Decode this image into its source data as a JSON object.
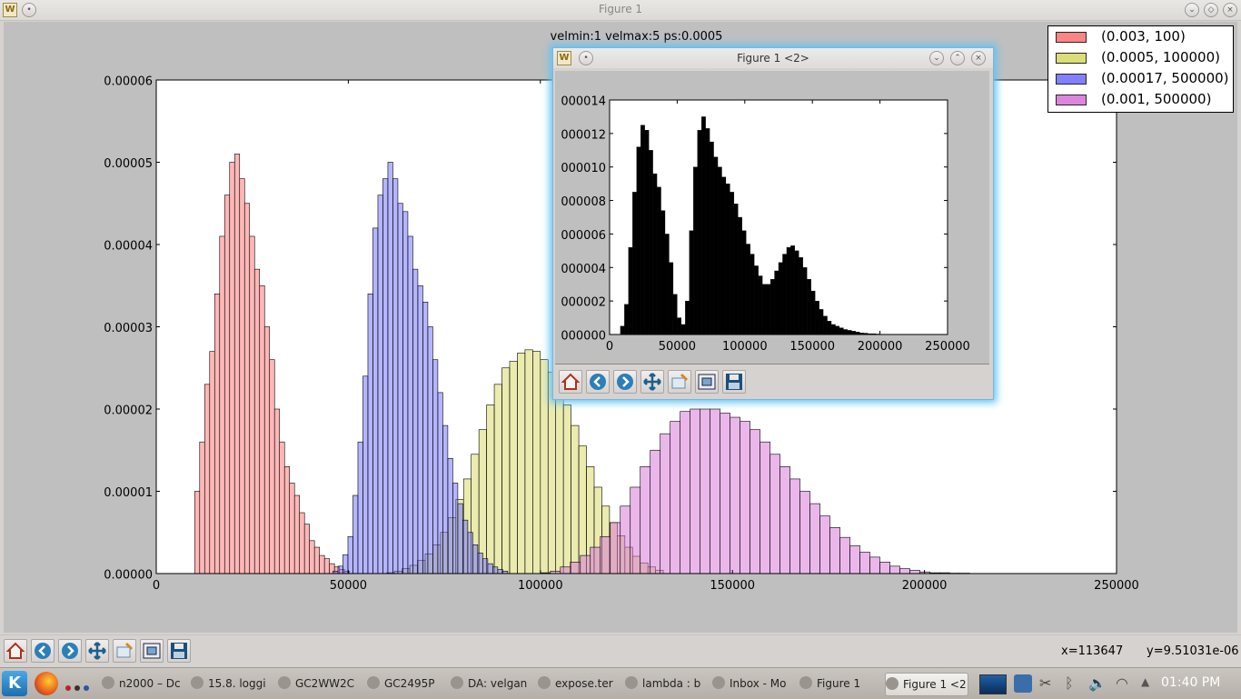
{
  "window": {
    "title": "Figure 1",
    "icon": "matplotlib-icon",
    "status": {
      "x": "x=113647",
      "y": "y=9.51031e-06"
    }
  },
  "toolbar": {
    "buttons": [
      {
        "name": "home-button",
        "icon": "home-icon"
      },
      {
        "name": "back-button",
        "icon": "arrow-left-icon"
      },
      {
        "name": "forward-button",
        "icon": "arrow-right-icon"
      },
      {
        "name": "pan-button",
        "icon": "move-icon"
      },
      {
        "name": "zoom-button",
        "icon": "zoom-rect-icon"
      },
      {
        "name": "subplots-button",
        "icon": "subplots-icon"
      },
      {
        "name": "save-button",
        "icon": "floppy-disk-icon"
      }
    ]
  },
  "sub_window": {
    "title": "Figure 1 <2>",
    "icon": "matplotlib-icon"
  },
  "taskbar": {
    "items": [
      {
        "label": "n2000 – Dc",
        "icon": "document-icon"
      },
      {
        "label": "15.8. loggi",
        "icon": "browser-icon"
      },
      {
        "label": "GC2WW2C",
        "icon": "browser-icon"
      },
      {
        "label": "GC2495P",
        "icon": "browser-icon"
      },
      {
        "label": "DA: velgan",
        "icon": "editor-icon"
      },
      {
        "label": "expose.ter",
        "icon": "terminal-icon"
      },
      {
        "label": "lambda : b",
        "icon": "terminal-icon"
      },
      {
        "label": "Inbox - Mo",
        "icon": "mail-icon"
      },
      {
        "label": "Figure 1",
        "icon": "matplotlib-icon"
      },
      {
        "label": "Figure 1 <2",
        "icon": "matplotlib-icon",
        "active": true
      }
    ],
    "clock": "01:40 PM"
  },
  "chart_data": [
    {
      "type": "bar",
      "title": "velmin:1 velmax:5 ps:0.0005",
      "xlim": [
        0,
        250000
      ],
      "ylim": [
        0,
        6e-05
      ],
      "xticks": [
        "0",
        "50000",
        "100000",
        "150000",
        "200000",
        "250000"
      ],
      "yticks": [
        "0.00000",
        "0.00001",
        "0.00002",
        "0.00003",
        "0.00004",
        "0.00005",
        "0.00006"
      ],
      "legend_position": "top-right",
      "series": [
        {
          "name": "(0.003, 100)",
          "color": "#ff6f6f",
          "bin_start": 10000,
          "bin_width": 1300,
          "values": [
            1e-05,
            1.6e-05,
            2.3e-05,
            2.7e-05,
            3.4e-05,
            4.1e-05,
            4.6e-05,
            5e-05,
            5.1e-05,
            4.8e-05,
            4.5e-05,
            4.1e-05,
            3.7e-05,
            3.5e-05,
            3e-05,
            2.6e-05,
            2e-05,
            1.6e-05,
            1.3e-05,
            1.1e-05,
            9.5e-06,
            7.4e-06,
            6e-06,
            4e-06,
            3.2e-06,
            2.2e-06,
            1.8e-06,
            1.2e-06,
            8e-07,
            5e-07,
            3e-07
          ]
        },
        {
          "name": "(0.0005, 100000)",
          "color": "#d8d860",
          "bin_start": 60000,
          "bin_width": 2000,
          "values": [
            1e-07,
            3e-07,
            6e-07,
            1e-06,
            1.6e-06,
            2.4e-06,
            3.5e-06,
            5e-06,
            6.8e-06,
            9e-06,
            1.15e-05,
            1.45e-05,
            1.75e-05,
            2.05e-05,
            2.3e-05,
            2.5e-05,
            2.58e-05,
            2.68e-05,
            2.72e-05,
            2.7e-05,
            2.6e-05,
            2.45e-05,
            2.3e-05,
            2.05e-05,
            1.8e-05,
            1.55e-05,
            1.3e-05,
            1.05e-05,
            8.2e-06,
            6.2e-06,
            4.6e-06,
            3.2e-06,
            2.1e-06,
            1.3e-06,
            8e-07,
            4e-07
          ]
        },
        {
          "name": "(0.00017, 500000)",
          "color": "#6c6cff",
          "bin_start": 46000,
          "bin_width": 1300,
          "values": [
            3e-07,
            9e-07,
            2.3e-06,
            4.5e-06,
            9.5e-06,
            1.6e-05,
            2.4e-05,
            3.4e-05,
            4.2e-05,
            4.6e-05,
            4.8e-05,
            5e-05,
            4.8e-05,
            4.5e-05,
            4.4e-05,
            4.1e-05,
            3.7e-05,
            3.5e-05,
            3.3e-05,
            3e-05,
            2.6e-05,
            2.2e-05,
            1.8e-05,
            1.4e-05,
            1.1e-05,
            8.5e-06,
            6.5e-06,
            5e-06,
            3.5e-06,
            2.5e-06,
            1.8e-06,
            1.2e-06,
            8e-07,
            5e-07,
            3e-07
          ]
        },
        {
          "name": "(0.001, 500000)",
          "color": "#d870d8",
          "bin_start": 100000,
          "bin_width": 2600,
          "values": [
            1e-07,
            3e-07,
            8e-07,
            1.4e-06,
            2.2e-06,
            3.2e-06,
            4.5e-06,
            6.2e-06,
            8.2e-06,
            1.05e-05,
            1.3e-05,
            1.5e-05,
            1.7e-05,
            1.85e-05,
            1.97e-05,
            2e-05,
            2e-05,
            2e-05,
            1.95e-05,
            1.9e-05,
            1.85e-05,
            1.75e-05,
            1.6e-05,
            1.45e-05,
            1.3e-05,
            1.15e-05,
            1e-05,
            8.5e-06,
            7e-06,
            5.6e-06,
            4.4e-06,
            3.4e-06,
            2.6e-06,
            2e-06,
            1.4e-06,
            9e-07,
            6e-07,
            4e-07,
            2e-07,
            1e-07,
            1e-07,
            5e-08,
            5e-08,
            2e-08,
            1e-08,
            1e-08,
            5e-09,
            5e-09,
            2e-09,
            1e-09
          ]
        }
      ]
    },
    {
      "type": "bar",
      "xlim": [
        0,
        250000
      ],
      "ylim": [
        0,
        0.00014
      ],
      "xticks": [
        "0",
        "50000",
        "100000",
        "150000",
        "200000",
        "250000"
      ],
      "yticks": [
        "000000",
        "000002",
        "000004",
        "000006",
        "000008",
        "000010",
        "000012",
        "000014"
      ],
      "series": [
        {
          "color": "#000000",
          "bin_start": 8000,
          "bin_width": 3000,
          "values": [
            5e-06,
            1.8e-05,
            5.2e-05,
            8.5e-05,
            0.000112,
            0.000125,
            0.000122,
            0.00011,
            9.6e-05,
            8.8e-05,
            7.4e-05,
            6e-05,
            4.3e-05,
            2.4e-05,
            1e-05,
            6e-06,
            2e-05,
            6.2e-05,
            0.0001,
            0.000122,
            0.00013,
            0.000123,
            0.000115,
            0.000106,
            0.0001,
            9.4e-05,
            9e-05,
            8.5e-05,
            7.8e-05,
            7e-05,
            6.2e-05,
            5.4e-05,
            4.8e-05,
            4.1e-05,
            3.5e-05,
            3e-05,
            3e-05,
            3.3e-05,
            3.8e-05,
            4.3e-05,
            4.8e-05,
            5.2e-05,
            5.3e-05,
            5e-05,
            4.6e-05,
            4e-05,
            3.3e-05,
            2.6e-05,
            2e-05,
            1.5e-05,
            1.1e-05,
            8e-06,
            6e-06,
            5e-06,
            4e-06,
            3e-06,
            2.5e-06,
            2e-06,
            1.5e-06,
            1e-06,
            8e-07,
            5e-07,
            5e-07,
            3e-07,
            2e-07,
            2e-07,
            1e-07,
            1e-07,
            1e-07,
            1e-07,
            1e-07,
            5e-08,
            5e-08,
            5e-08,
            5e-08,
            5e-08,
            5e-08
          ]
        }
      ]
    }
  ]
}
